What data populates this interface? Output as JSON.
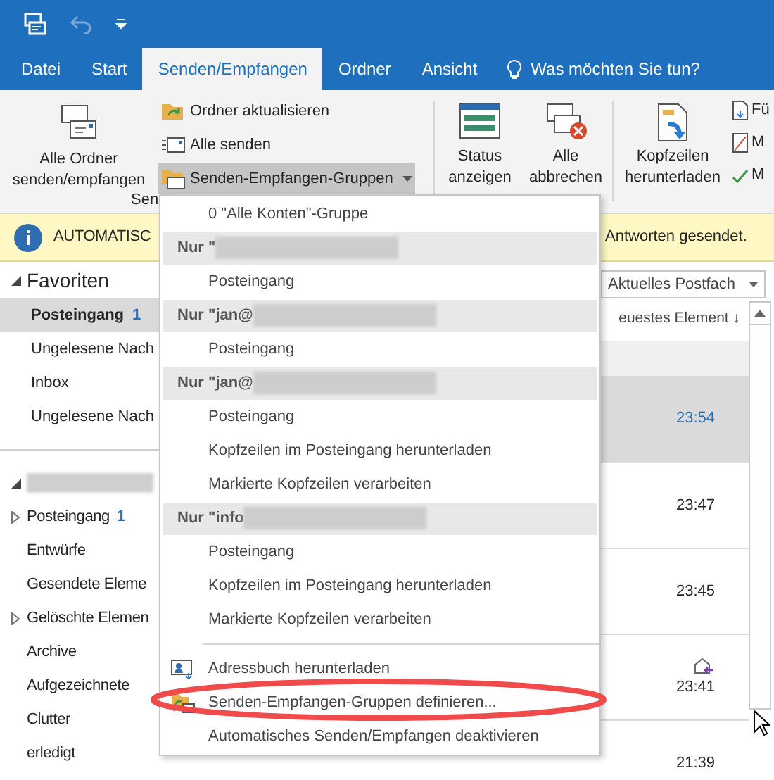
{
  "tabs": [
    {
      "label": "Datei",
      "selected": false
    },
    {
      "label": "Start",
      "selected": false
    },
    {
      "label": "Senden/Empfangen",
      "selected": true
    },
    {
      "label": "Ordner",
      "selected": false
    },
    {
      "label": "Ansicht",
      "selected": false
    }
  ],
  "tell_me": "Was möchten Sie tun?",
  "ribbon": {
    "big_button": "Alle Ordner senden/empfangen",
    "small_buttons": [
      {
        "label": "Ordner aktualisieren",
        "pressed": false,
        "dropdown": false
      },
      {
        "label": "Alle senden",
        "pressed": false,
        "dropdown": false
      },
      {
        "label": "Senden-Empfangen-Gruppen",
        "pressed": true,
        "dropdown": true
      }
    ],
    "group_label": "Sen",
    "status_button": "Status anzeigen",
    "cancel_button": "Alle abbrechen",
    "headers_button": "Kopfzeilen herunterladen",
    "side_buttons": [
      "Fü",
      "M",
      "M"
    ]
  },
  "info_bar": {
    "text_start": "AUTOMATISC",
    "text_end": "Antworten gesendet."
  },
  "folder_pane": {
    "favorites_header": "Favoriten",
    "favorites": [
      {
        "label": "Posteingang",
        "count": "1",
        "selected": true
      },
      {
        "label": "Ungelesene Nach",
        "selected": false
      },
      {
        "label": "Inbox",
        "selected": false
      },
      {
        "label": "Ungelesene Nach",
        "selected": false
      }
    ],
    "folders": [
      {
        "label": "Posteingang",
        "count": "1",
        "expandable": true
      },
      {
        "label": "Entwürfe",
        "expandable": false
      },
      {
        "label": "Gesendete Eleme",
        "expandable": false
      },
      {
        "label": "Gelöschte Elemen",
        "expandable": true
      },
      {
        "label": "Archive",
        "expandable": false
      },
      {
        "label": "Aufgezeichnete",
        "expandable": false
      },
      {
        "label": "Clutter",
        "expandable": false
      },
      {
        "label": "erledigt",
        "expandable": false
      }
    ]
  },
  "mail_list": {
    "scope": "Aktuelles Postfach",
    "sort_label": "euestes Element ↓",
    "rows": [
      {
        "time": "23:54",
        "selected": true,
        "replied": false
      },
      {
        "time": "23:47",
        "selected": false,
        "replied": false
      },
      {
        "time": "23:45",
        "selected": false,
        "replied": false
      },
      {
        "time": "23:41",
        "selected": false,
        "replied": true
      },
      {
        "time": "21:39",
        "selected": false,
        "replied": false
      }
    ]
  },
  "menu": [
    {
      "kind": "item",
      "label": "0 \"Alle Konten\"-Gruppe"
    },
    {
      "kind": "header",
      "label": "Nur \""
    },
    {
      "kind": "item",
      "label": "Posteingang"
    },
    {
      "kind": "header",
      "label": "Nur \"jan@"
    },
    {
      "kind": "item",
      "label": "Posteingang"
    },
    {
      "kind": "header",
      "label": "Nur \"jan@"
    },
    {
      "kind": "item",
      "label": "Posteingang"
    },
    {
      "kind": "item",
      "label": "Kopfzeilen im Posteingang herunterladen"
    },
    {
      "kind": "item",
      "label": "Markierte Kopfzeilen verarbeiten"
    },
    {
      "kind": "header",
      "label": "Nur \"info"
    },
    {
      "kind": "item",
      "label": "Posteingang"
    },
    {
      "kind": "item",
      "label": "Kopfzeilen im Posteingang herunterladen"
    },
    {
      "kind": "item",
      "label": "Markierte Kopfzeilen verarbeiten"
    },
    {
      "kind": "separator"
    },
    {
      "kind": "addressbook",
      "label": "Adressbuch herunterladen"
    },
    {
      "kind": "define",
      "label": "Senden-Empfangen-Gruppen definieren..."
    },
    {
      "kind": "item",
      "label": "Automatisches Senden/Empfangen deaktivieren"
    }
  ]
}
